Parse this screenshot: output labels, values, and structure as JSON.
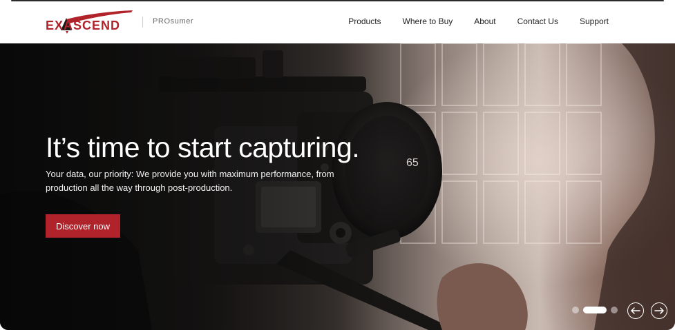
{
  "brand": {
    "logo_text": "EXASCEND",
    "tagline": "PROsumer",
    "accent_color": "#b0232a"
  },
  "nav": {
    "items": [
      {
        "label": "Products"
      },
      {
        "label": "Where to Buy"
      },
      {
        "label": "About"
      },
      {
        "label": "Contact Us"
      },
      {
        "label": "Support"
      }
    ]
  },
  "hero": {
    "headline": "It’s time to start capturing.",
    "subtext": "Your data, our priority: We provide you with maximum performance, from production all the way through post-production.",
    "cta_label": "Discover now",
    "lens_marking": "65",
    "carousel": {
      "slide_count": 3,
      "active_index": 1,
      "prev_icon": "arrow-left-icon",
      "next_icon": "arrow-right-icon"
    }
  }
}
